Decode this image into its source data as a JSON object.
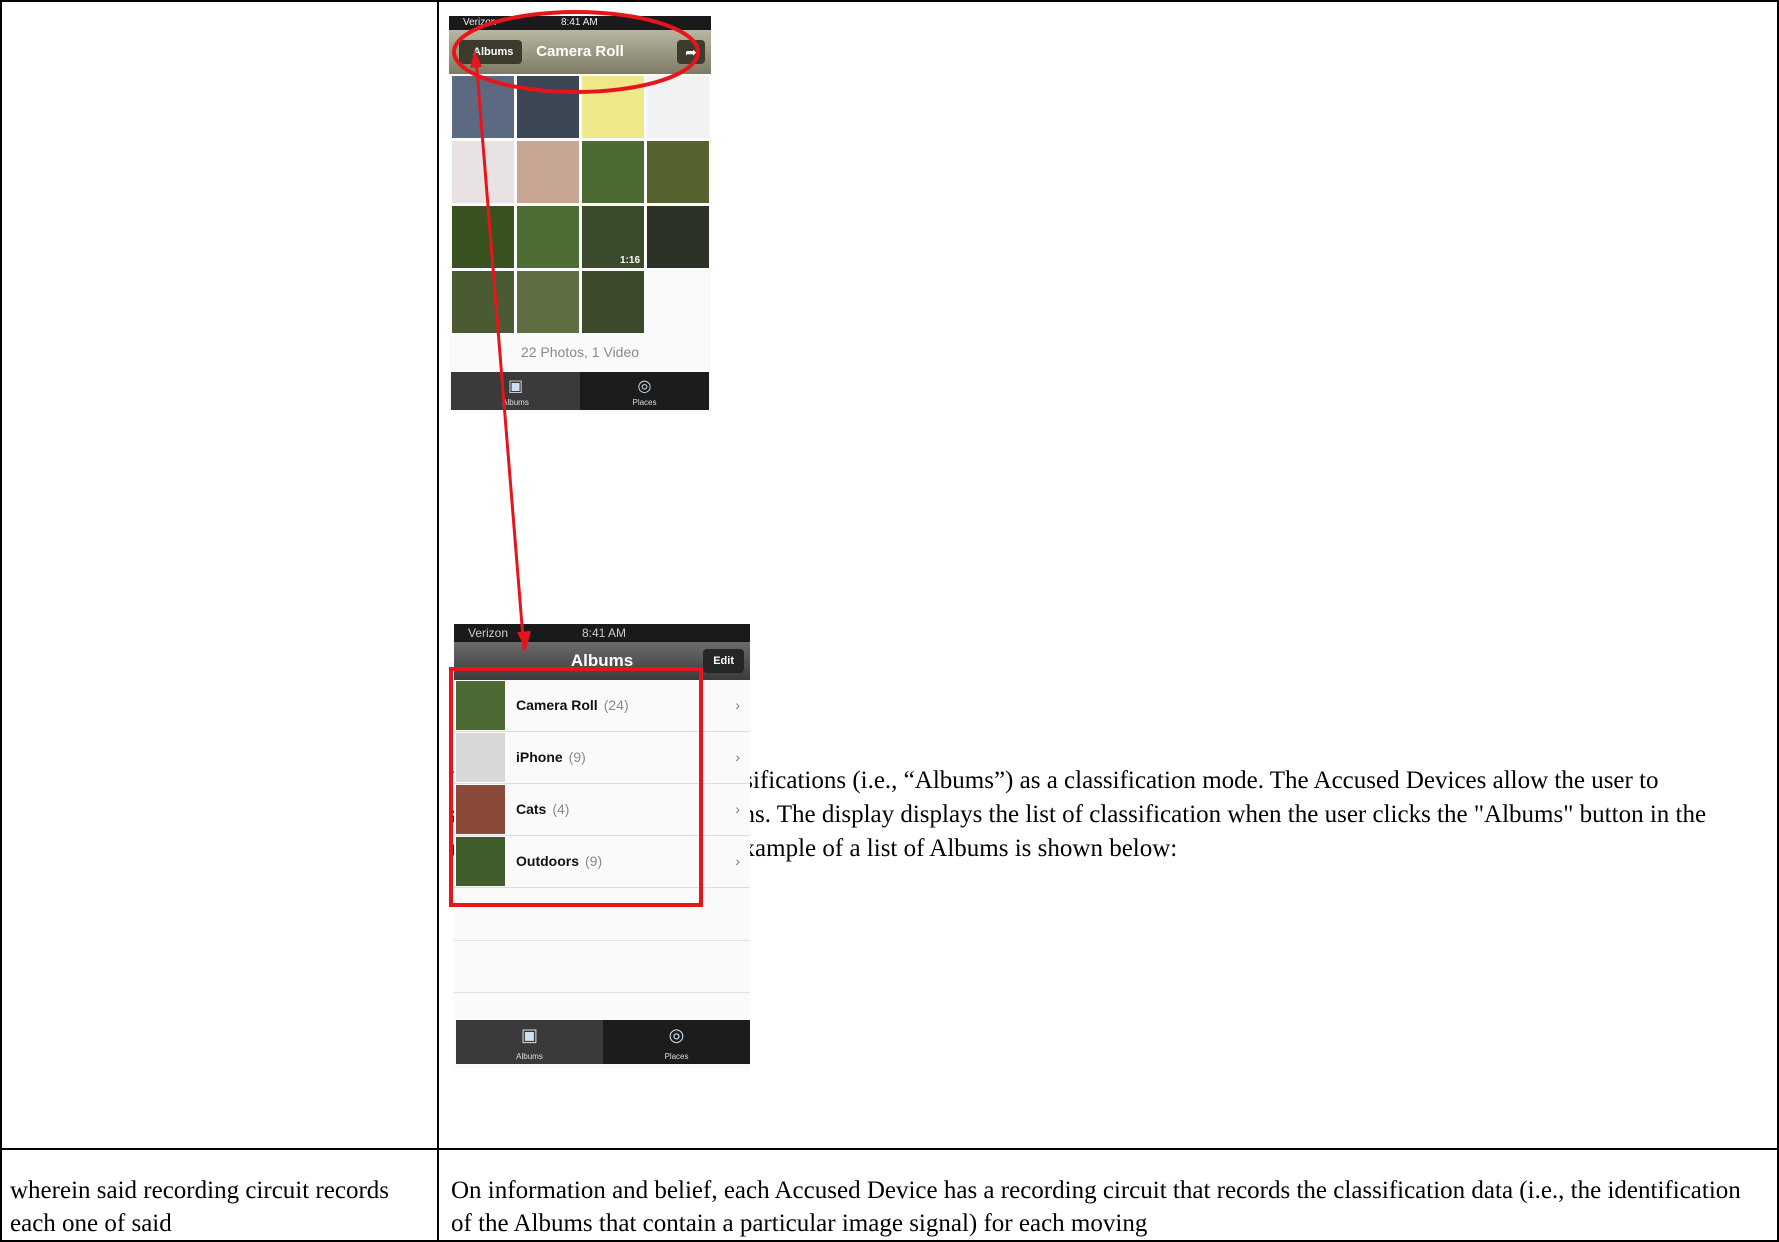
{
  "screen1": {
    "status_carrier": "Verizon",
    "status_time": "8:41 AM",
    "back_label": "Albums",
    "title": "Camera Roll",
    "video_duration": "1:16",
    "count": "22 Photos, 1 Video",
    "tabs": [
      "Albums",
      "Places"
    ]
  },
  "paragraph": "The display also lists the classifications (i.e., “Albums”)  as a classification mode.  The Accused Devices allow the user to arbitrarily create classifications.  The display displays the list of classification when the user clicks the \"Albums\" button in the upper left hand corner.  One example of a list of Albums is shown below:",
  "screen2": {
    "status_carrier": "Verizon",
    "status_time": "8:41 AM",
    "title": "Albums",
    "edit_label": "Edit",
    "albums": [
      {
        "name": "Camera Roll",
        "count": "(24)"
      },
      {
        "name": "iPhone",
        "count": "(9)"
      },
      {
        "name": "Cats",
        "count": "(4)"
      },
      {
        "name": "Outdoors",
        "count": "(9)"
      }
    ],
    "tabs": [
      "Albums",
      "Places"
    ]
  },
  "claim_row": {
    "left": "wherein said recording circuit records each one of said",
    "right": "On information and belief, each Accused Device has a recording circuit that records the classification data (i.e., the identification of the Albums that contain a particular image signal) for each moving"
  },
  "annotation_color": "#e8141c"
}
